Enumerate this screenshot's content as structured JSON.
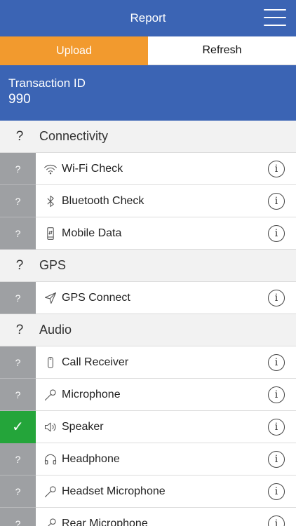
{
  "header": {
    "title": "Report",
    "menu_icon": "hamburger-menu-icon"
  },
  "actions": {
    "upload_label": "Upload",
    "refresh_label": "Refresh"
  },
  "transaction": {
    "label": "Transaction ID",
    "value": "990"
  },
  "colors": {
    "primary": "#3b64b4",
    "upload": "#f29a2e",
    "pending": "#9ea0a3",
    "passed": "#24a53a"
  },
  "sections": [
    {
      "status": "?",
      "name": "Connectivity",
      "items": [
        {
          "status": "?",
          "label": "Wi-Fi Check",
          "icon": "wifi-icon",
          "info": "i"
        },
        {
          "status": "?",
          "label": "Bluetooth Check",
          "icon": "bluetooth-icon",
          "info": "i"
        },
        {
          "status": "?",
          "label": "Mobile Data",
          "icon": "mobile-data-icon",
          "info": "i"
        }
      ]
    },
    {
      "status": "?",
      "name": "GPS",
      "items": [
        {
          "status": "?",
          "label": "GPS Connect",
          "icon": "location-arrow-icon",
          "info": "i"
        }
      ]
    },
    {
      "status": "?",
      "name": "Audio",
      "items": [
        {
          "status": "?",
          "label": "Call Receiver",
          "icon": "phone-receiver-icon",
          "info": "i"
        },
        {
          "status": "?",
          "label": "Microphone",
          "icon": "microphone-icon",
          "info": "i"
        },
        {
          "status": "✓",
          "label": "Speaker",
          "icon": "speaker-icon",
          "info": "i"
        },
        {
          "status": "?",
          "label": "Headphone",
          "icon": "headphone-icon",
          "info": "i"
        },
        {
          "status": "?",
          "label": "Headset Microphone",
          "icon": "microphone-icon",
          "info": "i"
        },
        {
          "status": "?",
          "label": "Rear Microphone",
          "icon": "microphone-icon",
          "info": "i"
        }
      ]
    }
  ]
}
